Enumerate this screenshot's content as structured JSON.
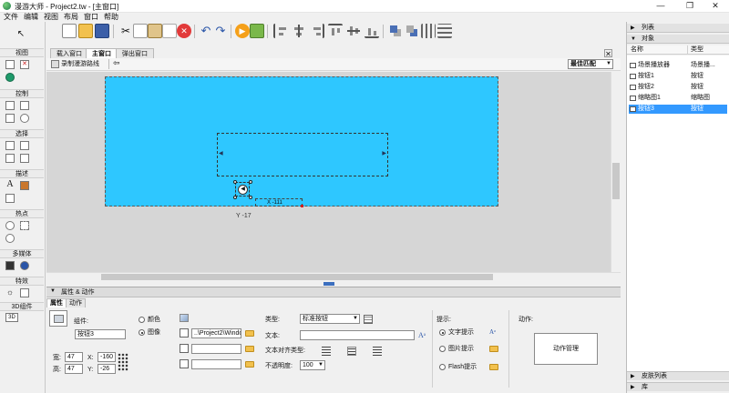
{
  "window": {
    "app_name": "漫游大师",
    "title": "Project2.tw - [主窗口]",
    "minimize": "—",
    "restore": "❐",
    "close": "✕"
  },
  "menu": [
    "文件",
    "编辑",
    "视图",
    "布局",
    "窗口",
    "帮助"
  ],
  "left_toolbox": {
    "sections": [
      "视图",
      "控制",
      "选择",
      "描述",
      "热点",
      "多媒体",
      "特效",
      "3D组件"
    ],
    "text_tool": "A"
  },
  "tabs": [
    {
      "label": "载入窗口",
      "active": false
    },
    {
      "label": "主窗口",
      "active": true
    },
    {
      "label": "弹出窗口",
      "active": false
    }
  ],
  "subbar": {
    "record_path_label": "录制漫游路线",
    "back_arrow": "⇦",
    "fit_select": "最佳匹配"
  },
  "stage": {
    "background_color": "#2ec7ff",
    "button_glyph": "◀",
    "x_readout": "X -111",
    "y_readout": "Y -17"
  },
  "props_panel": {
    "title": "属性 & 动作",
    "tabs": [
      "属性",
      "动作"
    ],
    "component_label": "组件:",
    "component_name": "按钮3",
    "width_label": "宽:",
    "width_value": "47",
    "height_label": "高:",
    "height_value": "47",
    "x_label": "X:",
    "x_value": "-160",
    "y_label": "Y:",
    "y_value": "-26",
    "color_option": "颜色",
    "image_option": "图像",
    "image_path": "..\\Project2\\Windo",
    "type_label": "类型:",
    "type_value": "标准按钮",
    "text_label": "文本:",
    "text_value": "",
    "align_label": "文本对齐类型:",
    "opacity_label": "不透明度:",
    "opacity_value": "100",
    "tip_label": "提示:",
    "tip_options": [
      "文字提示",
      "图片提示",
      "Flash提示"
    ],
    "action_label": "动作:",
    "action_button": "动作管理"
  },
  "right_panel": {
    "list_header": "列表",
    "objects_header": "对象",
    "col_name": "名称",
    "col_type": "类型",
    "rows": [
      {
        "name": "场景播放器",
        "type": "场景播..."
      },
      {
        "name": "按钮1",
        "type": "按钮"
      },
      {
        "name": "按钮2",
        "type": "按钮"
      },
      {
        "name": "缩略图1",
        "type": "缩略图"
      },
      {
        "name": "按钮3",
        "type": "按钮",
        "selected": true
      }
    ],
    "skin_list": "皮肤列表",
    "library": "库"
  },
  "colors": {
    "accent": "#3399ff",
    "stage": "#2ec7ff"
  }
}
